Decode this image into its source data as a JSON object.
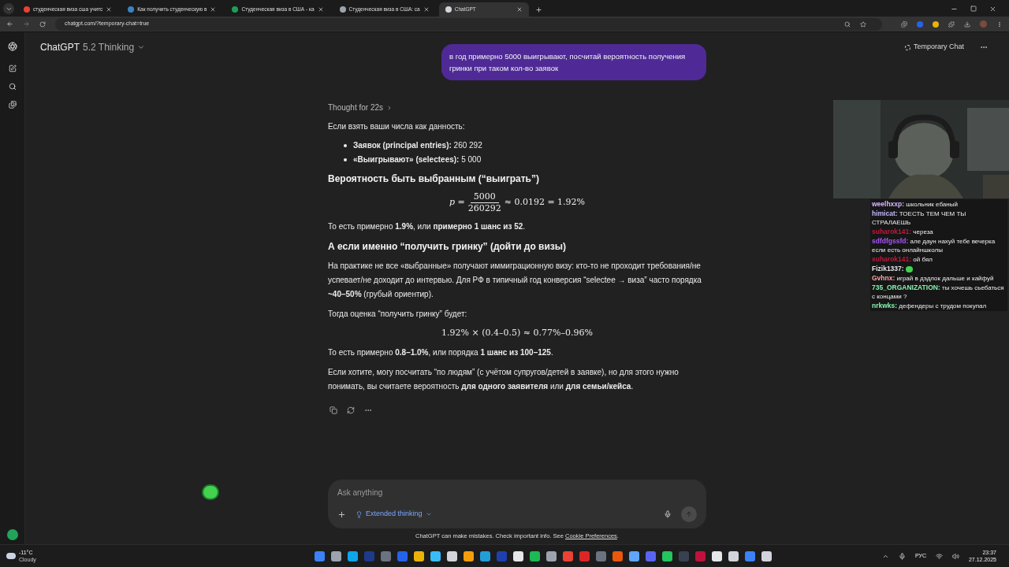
{
  "browser": {
    "tabs": [
      {
        "title": "студенческая виза сша учитс",
        "selected": false,
        "color": "#e94235"
      },
      {
        "title": "Как получить студенческую в",
        "selected": false,
        "color": "#3b82c4"
      },
      {
        "title": "Студенческая виза в США - ка",
        "selected": false,
        "color": "#1f9d55"
      },
      {
        "title": "Студенческая виза в США: са",
        "selected": false,
        "color": "#9ca3af"
      },
      {
        "title": "ChatGPT",
        "selected": true,
        "color": "#d1d5db"
      }
    ],
    "url": "chatgpt.com/?temporary-chat=true"
  },
  "header": {
    "model_name": "ChatGPT",
    "model_version": "5.2 Thinking",
    "temporary_chat": "Temporary Chat"
  },
  "user_message": "в год примерно 5000 выигрывают, посчитай вероятность получения гринки при таком кол-во заявок",
  "thought": "Thought for 22s",
  "answer": [
    {
      "kind": "paragraph",
      "text": "Если взять ваши числа как данность:"
    },
    {
      "kind": "bullets",
      "items": [
        "**Заявок (principal entries):** 260 292",
        "**«Выигрывают» (selectees):** 5 000"
      ]
    },
    {
      "kind": "heading",
      "text": "Вероятность быть выбранным (“выиграть”)"
    },
    {
      "kind": "fraction",
      "lhs": "p =",
      "numerator": "5000",
      "denominator": "260292",
      "rhs": "≈ 0.0192 = 1.92%"
    },
    {
      "kind": "paragraph",
      "text": "То есть примерно **1.9%**, или **примерно 1 шанс из 52**."
    },
    {
      "kind": "heading",
      "text": "А если именно “получить гринку” (дойти до визы)"
    },
    {
      "kind": "paragraph",
      "text": "На практике не все «выбранные» получают иммиграционную визу: кто-то не проходит требования/не успевает/не доходит до интервью. Для РФ в типичный год конверсия “selectee → виза” часто порядка **~40–50%** (грубый ориентир)."
    },
    {
      "kind": "paragraph",
      "text": "Тогда оценка “получить гринку” будет:"
    },
    {
      "kind": "formula",
      "text": "1.92% × (0.4–0.5) ≈ 0.77%–0.96%"
    },
    {
      "kind": "paragraph",
      "text": "То есть примерно **0.8–1.0%**, или порядка **1 шанс из 100–125**."
    },
    {
      "kind": "paragraph",
      "text": "Если хотите, могу посчитать “по людям” (с учётом супругов/детей в заявке), но для этого нужно понимать, вы считаете вероятность **для одного заявителя** или **для семьи/кейса**."
    }
  ],
  "composer": {
    "placeholder": "Ask anything",
    "mode": "Extended thinking"
  },
  "footer": {
    "text": "ChatGPT can make mistakes. Check important info. See",
    "link": "Cookie Preferences",
    "end": "."
  },
  "stream_chat": [
    {
      "kind": "text",
      "user": "weelhxxp:",
      "color": "#d8b4fe",
      "text": "школьник ебаный"
    },
    {
      "kind": "text",
      "user": "himicat:",
      "color": "#c4b5fd",
      "text": "ТОЕСТЬ ТЕМ ЧЕМ ТЫ СТРАЛАЕШЬ"
    },
    {
      "kind": "text",
      "user": "suharok141:",
      "color": "#b91c3c",
      "text": "череза"
    },
    {
      "kind": "text",
      "user": "sdfdfgssfd:",
      "color": "#a855f7",
      "text": "але даун нахуй тебе вечерка если есть онлайншколы"
    },
    {
      "kind": "text",
      "user": "suharok141:",
      "color": "#b91c3c",
      "text": "ой бял"
    },
    {
      "kind": "emote",
      "user": "Fizik1337:",
      "color": "#e5e7eb"
    },
    {
      "kind": "text",
      "user": "Gvhnx:",
      "color": "#fca5a5",
      "text": "играй в дэдлок дальше и кайфуй"
    },
    {
      "kind": "text",
      "user": "735_ORGANIZATION:",
      "color": "#86efac",
      "text": "ты хочешь сьебаться с концами ?"
    },
    {
      "kind": "text",
      "user": "nrkwks:",
      "color": "#86efac",
      "text": "дефендеры с трудом покупал"
    }
  ],
  "taskbar": {
    "temperature": "-11°C",
    "weather": "Cloudy",
    "language": "РУС",
    "time": "23:37",
    "date": "27.12.2025"
  }
}
